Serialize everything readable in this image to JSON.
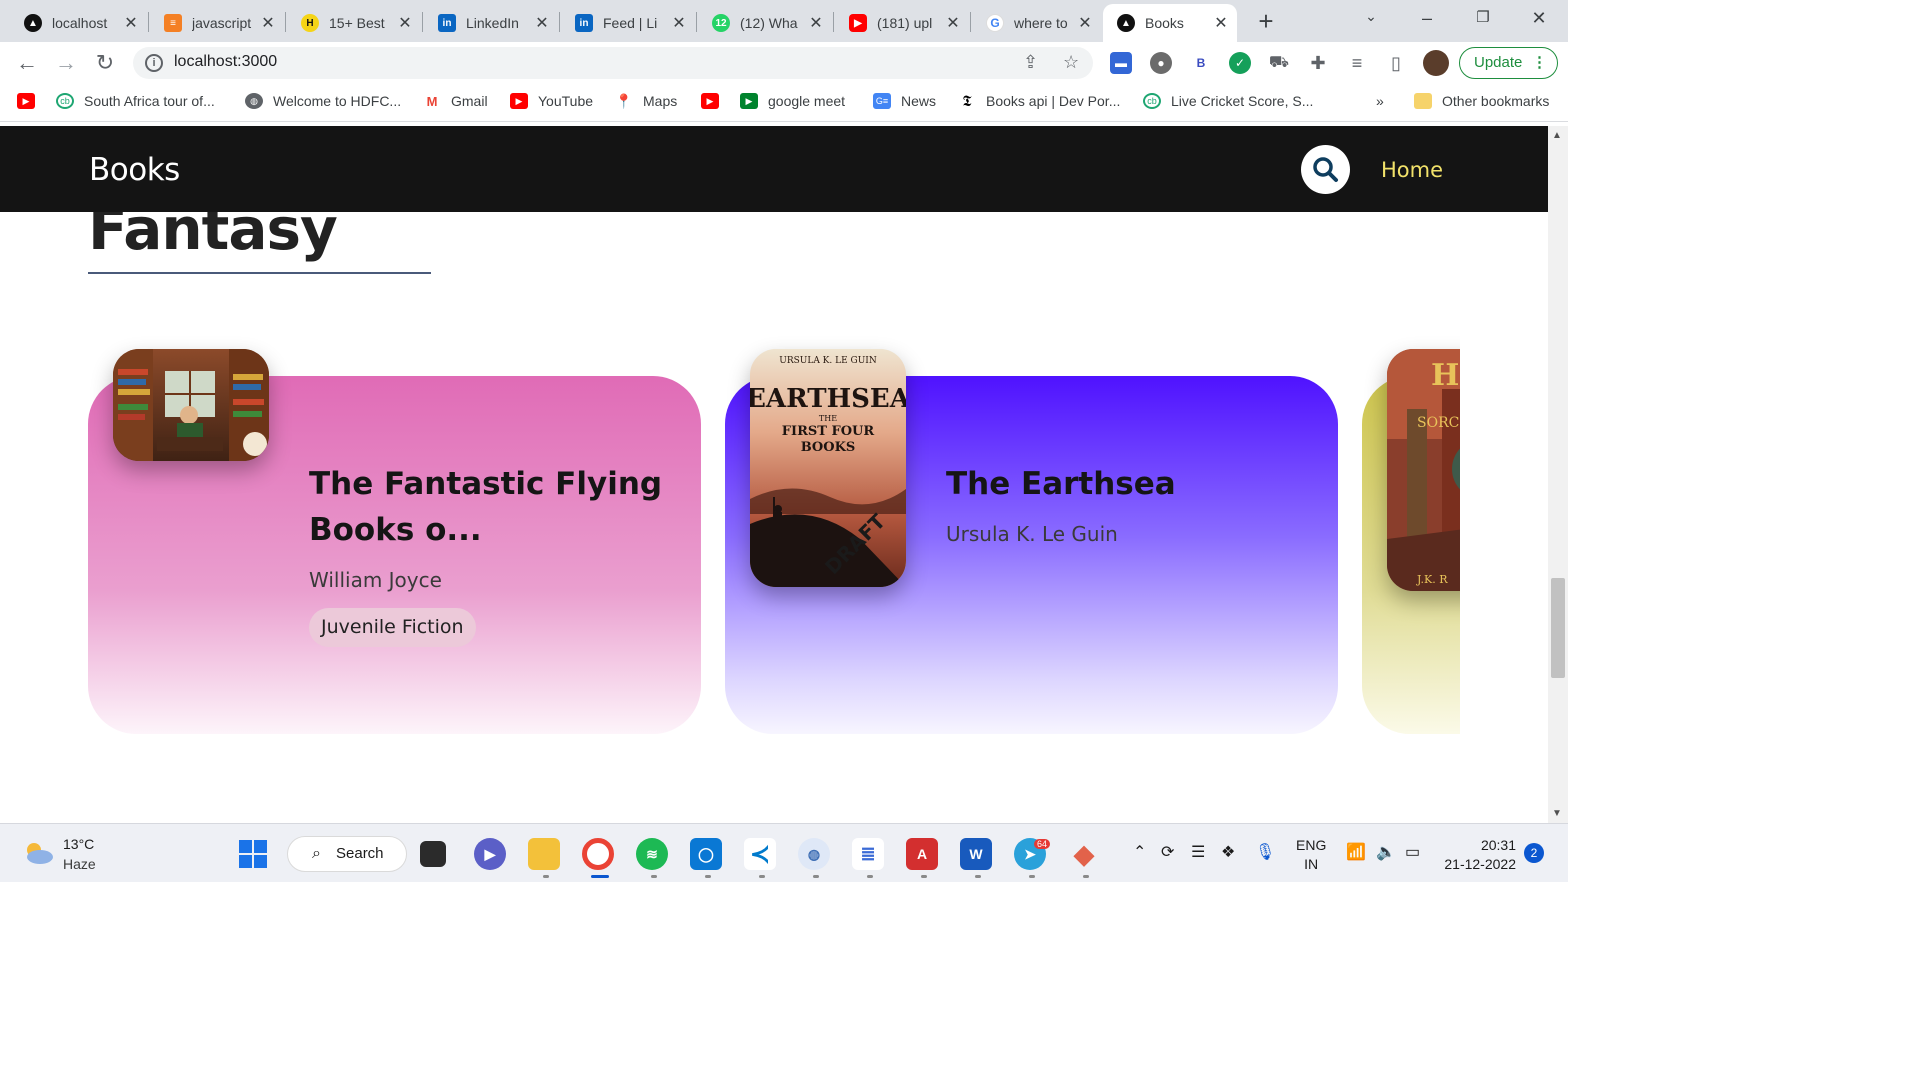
{
  "browser": {
    "tabs": [
      {
        "label": "localhost",
        "icon": "triangle-logo-icon",
        "color": "#000000"
      },
      {
        "label": "javascript",
        "icon": "stackoverflow-icon",
        "color": "#f48024"
      },
      {
        "label": "15+ Best",
        "icon": "h-logo-icon",
        "color": "#f5c518"
      },
      {
        "label": "LinkedIn",
        "icon": "linkedin-icon",
        "color": "#0a66c2"
      },
      {
        "label": "Feed | Li",
        "icon": "linkedin-icon",
        "color": "#0a66c2"
      },
      {
        "label": "(12) Wha",
        "icon": "whatsapp-icon",
        "color": "#25d366"
      },
      {
        "label": "(181) upl",
        "icon": "youtube-icon",
        "color": "#ff0000"
      },
      {
        "label": "where to",
        "icon": "google-icon",
        "color": "#4285f4"
      },
      {
        "label": "Books",
        "icon": "triangle-logo-icon",
        "color": "#000000",
        "active": true
      }
    ],
    "whatsapp_badge": "12",
    "url": "localhost:3000",
    "update_label": "Update",
    "bookmarks": [
      {
        "label": "",
        "icon": "youtube-icon",
        "color": "#ff0000"
      },
      {
        "label": "South Africa tour of...",
        "icon": "cricbuzz-icon",
        "color": "#1ea672"
      },
      {
        "label": "Welcome to HDFC...",
        "icon": "globe-icon",
        "color": "#5f6368"
      },
      {
        "label": "Gmail",
        "icon": "gmail-icon",
        "color": "#ea4335"
      },
      {
        "label": "YouTube",
        "icon": "youtube-icon",
        "color": "#ff0000"
      },
      {
        "label": "Maps",
        "icon": "maps-pin-icon",
        "color": "#34a853"
      },
      {
        "label": "",
        "icon": "youtube-icon",
        "color": "#ff0000"
      },
      {
        "label": "google meet",
        "icon": "meet-icon",
        "color": "#00832d"
      },
      {
        "label": "News",
        "icon": "google-news-icon",
        "color": "#4285f4"
      },
      {
        "label": "Books api | Dev Por...",
        "icon": "nyt-icon",
        "color": "#000000"
      },
      {
        "label": "Live Cricket Score, S...",
        "icon": "cricbuzz-icon",
        "color": "#1ea672"
      }
    ],
    "bookmarks_overflow": "»",
    "other_bookmarks": "Other bookmarks"
  },
  "app": {
    "brand": "Books",
    "nav_home": "Home",
    "section_title": "Fantasy",
    "accent_color": "#f2e26a",
    "books": [
      {
        "title_line1": "The Fantastic Flying",
        "title_line2": "Books o...",
        "author": "William Joyce",
        "genre": "Juvenile Fiction",
        "card_color": "#e06bb6"
      },
      {
        "title_line1": "The Earthsea",
        "author": "Ursula K. Le Guin",
        "card_color": "#4f12ff",
        "cover_text": {
          "author": "URSULA K. LE GUIN",
          "title": "EARTHSEA",
          "subtitle_1": "THE",
          "subtitle_2": "FIRST FOUR",
          "subtitle_3": "BOOKS",
          "stamp": "DRAFT"
        }
      },
      {
        "title_line1": "",
        "author": "",
        "card_color": "#cfc64e",
        "cover_text": {
          "title": "Harry",
          "subtitle": "SORCER",
          "footer": "J.K. R"
        }
      }
    ]
  },
  "taskbar": {
    "temperature": "13°C",
    "condition": "Haze",
    "search_label": "Search",
    "language_line1": "ENG",
    "language_line2": "IN",
    "time": "20:31",
    "date": "21-12-2022",
    "notifications": "2",
    "telegram_badge": "64"
  }
}
